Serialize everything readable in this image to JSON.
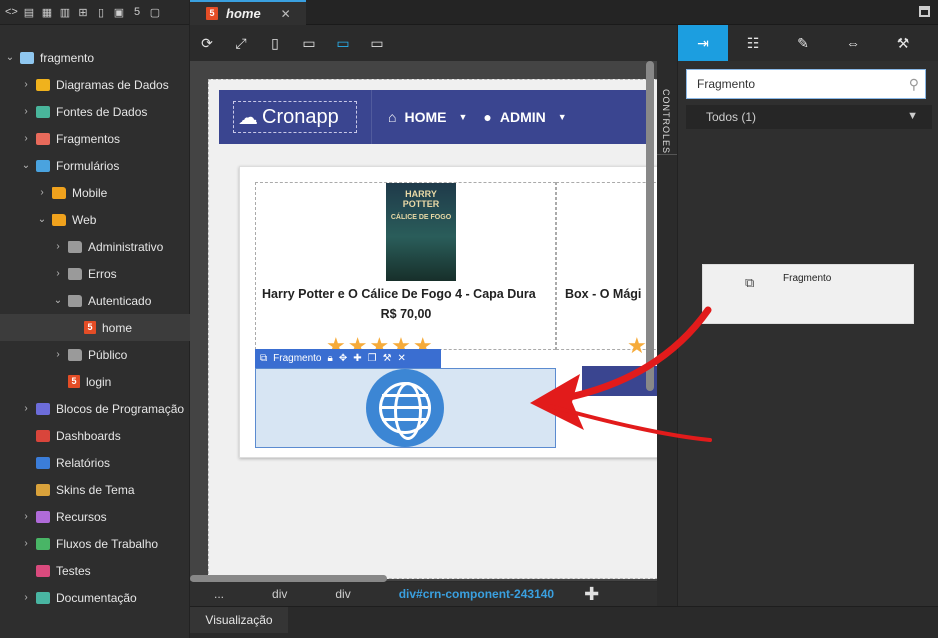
{
  "sidebar": {
    "toolbar_icons": [
      "code-icon",
      "file-icon",
      "layout-icon",
      "table-icon",
      "tree-icon",
      "mobile-icon",
      "page-icon",
      "html5-icon",
      "file2-icon"
    ],
    "tree": [
      {
        "label": "fragmento",
        "level": 0,
        "expanded": true
      },
      {
        "label": "Diagramas de Dados",
        "level": 1
      },
      {
        "label": "Fontes de Dados",
        "level": 1
      },
      {
        "label": "Fragmentos",
        "level": 1
      },
      {
        "label": "Formulários",
        "level": 1,
        "expanded": true
      },
      {
        "label": "Mobile",
        "level": 2
      },
      {
        "label": "Web",
        "level": 2,
        "expanded": true
      },
      {
        "label": "Administrativo",
        "level": 3
      },
      {
        "label": "Erros",
        "level": 3
      },
      {
        "label": "Autenticado",
        "level": 3,
        "expanded": true
      },
      {
        "label": "home",
        "level": 4,
        "selected": true
      },
      {
        "label": "Público",
        "level": 3
      },
      {
        "label": "login",
        "level": 3
      },
      {
        "label": "Blocos de Programação",
        "level": 1
      },
      {
        "label": "Dashboards",
        "level": 1
      },
      {
        "label": "Relatórios",
        "level": 1
      },
      {
        "label": "Skins de Tema",
        "level": 1
      },
      {
        "label": "Recursos",
        "level": 1
      },
      {
        "label": "Fluxos de Trabalho",
        "level": 1
      },
      {
        "label": "Testes",
        "level": 1
      },
      {
        "label": "Documentação",
        "level": 1
      }
    ]
  },
  "tab": {
    "label": "home",
    "close": "✕"
  },
  "navbar": {
    "logo_text": "Cronapp",
    "home_label": "HOME",
    "admin_label": "ADMIN"
  },
  "product": {
    "title": "Harry Potter e O Cálice De Fogo 4 - Capa Dura",
    "price": "R$ 70,00",
    "book_text": "HARRY POTTER",
    "book_subtext": "CÁLICE DE FOGO",
    "second_title": "Box - O Mági",
    "stars": "★★★★★"
  },
  "fragment_bar": {
    "label": "Fragmento"
  },
  "controls_tab": "CONTROLES",
  "breadcrumbs": [
    "...",
    "div",
    "div",
    "div#crn-component-243140"
  ],
  "bottom_tab": "Visualização",
  "right_panel": {
    "search_value": "Fragmento",
    "filter_label": "Todos (1)",
    "component_label": "Fragmento"
  },
  "colors": {
    "accent": "#1c9ee0",
    "navbar": "#3a4590",
    "star": "#f6ab3a",
    "html5": "#e44d26"
  }
}
